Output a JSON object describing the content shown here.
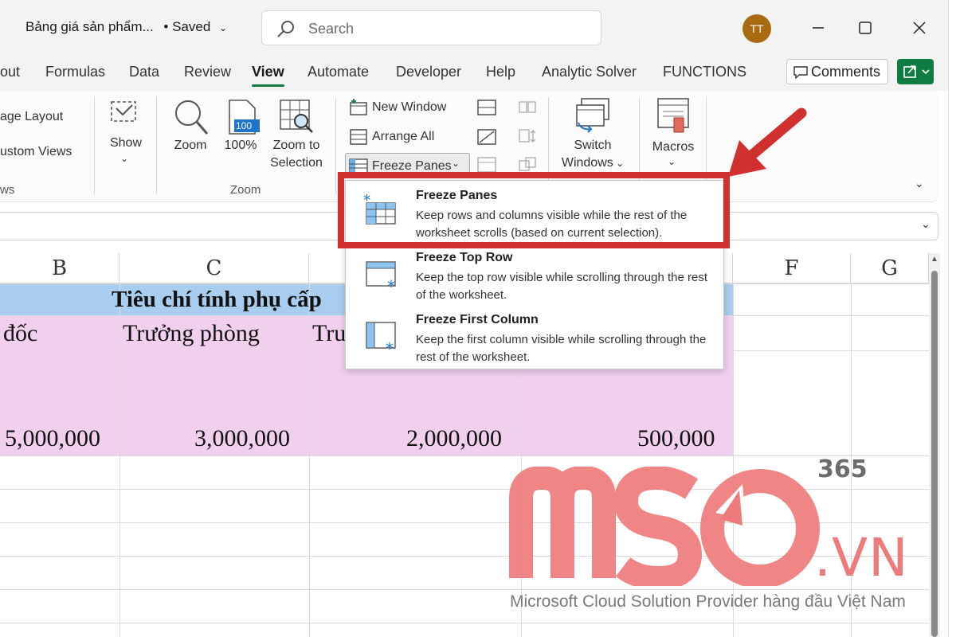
{
  "titlebar": {
    "doc_title": "Bảng giá sản phẩm...",
    "status": "• Saved",
    "search_placeholder": "Search",
    "avatar_initials": "TT"
  },
  "tabs": [
    "out",
    "Formulas",
    "Data",
    "Review",
    "View",
    "Automate",
    "Developer",
    "Help",
    "Analytic Solver",
    "FUNCTIONS"
  ],
  "active_tab": "View",
  "comments_label": "Comments",
  "ribbon": {
    "page_layout": "age Layout",
    "custom_views": "ustom Views",
    "views_group_label": "ws",
    "show_label": "Show",
    "zoom_label": "Zoom",
    "hundred_label": "100%",
    "zoom_to_selection_1": "Zoom to",
    "zoom_to_selection_2": "Selection",
    "zoom_group_label": "Zoom",
    "new_window": "New Window",
    "arrange_all": "Arrange All",
    "freeze_panes": "Freeze Panes",
    "switch_windows_1": "Switch",
    "switch_windows_2": "Windows",
    "macros": "Macros",
    "icon_100": "100"
  },
  "columns": [
    "B",
    "C",
    "F",
    "G"
  ],
  "sheet": {
    "header_row": "Tiêu chí tính phụ cấp",
    "row2": [
      "đốc",
      "Trưởng phòng",
      "Tru"
    ],
    "row3": [
      "5,000,000",
      "3,000,000",
      "2,000,000",
      "500,000"
    ]
  },
  "menu": {
    "items": [
      {
        "title": "Freeze Panes",
        "desc": "Keep rows and columns visible while the rest of the worksheet scrolls (based on current selection)."
      },
      {
        "title": "Freeze Top Row",
        "desc": "Keep the top row visible while scrolling through the rest of the worksheet."
      },
      {
        "title": "Freeze First Column",
        "desc": "Keep the first column visible while scrolling through the rest of the worksheet."
      }
    ]
  },
  "watermark": {
    "superscript": "365",
    "domain": ".VN",
    "tagline": "Microsoft Cloud Solution Provider hàng đầu Việt Nam"
  },
  "colors": {
    "excel_green": "#107c41",
    "highlight_red": "#d0312f",
    "header_blue": "#a9cdee",
    "row_pink": "#f1d0ee",
    "watermark_pink": "#ee7b7b"
  }
}
